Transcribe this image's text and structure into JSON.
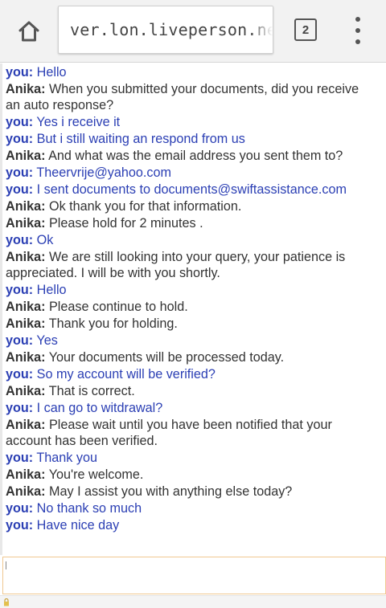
{
  "browser": {
    "url": "ver.lon.liveperson.net/",
    "tab_count": "2",
    "icons": {
      "home": "home-icon",
      "tabs": "tab-switcher-icon",
      "menu": "overflow-menu-icon",
      "secure": "lock-icon"
    }
  },
  "colors": {
    "you": "#2b3fb4",
    "agent": "#333333",
    "input_border": "#f0c890"
  },
  "chat": {
    "messages": [
      {
        "sender": "you",
        "label": "you:",
        "text": "Hello"
      },
      {
        "sender": "agent",
        "label": "Anika:",
        "text": "When you submitted your documents, did you receive an auto response?"
      },
      {
        "sender": "you",
        "label": "you:",
        "text": "Yes i receive it"
      },
      {
        "sender": "you",
        "label": "you:",
        "text": "But i still waiting an respond from us"
      },
      {
        "sender": "agent",
        "label": "Anika:",
        "text": "And what was the email address you sent them to?"
      },
      {
        "sender": "you",
        "label": "you:",
        "text": "Theervrije@yahoo.com"
      },
      {
        "sender": "you",
        "label": "you:",
        "text": "I sent documents to documents@swiftassistance.com"
      },
      {
        "sender": "agent",
        "label": "Anika:",
        "text": "Ok thank you for that information."
      },
      {
        "sender": "agent",
        "label": "Anika:",
        "text": "Please hold for 2 minutes ."
      },
      {
        "sender": "you",
        "label": "you:",
        "text": "Ok"
      },
      {
        "sender": "agent",
        "label": "Anika:",
        "text": "We are still looking into your query, your patience is appreciated. I will be with you shortly."
      },
      {
        "sender": "you",
        "label": "you:",
        "text": "Hello"
      },
      {
        "sender": "agent",
        "label": "Anika:",
        "text": "Please continue to hold."
      },
      {
        "sender": "agent",
        "label": "Anika:",
        "text": "Thank you for holding."
      },
      {
        "sender": "you",
        "label": "you:",
        "text": "Yes"
      },
      {
        "sender": "agent",
        "label": "Anika:",
        "text": "Your documents will be processed today."
      },
      {
        "sender": "you",
        "label": "you:",
        "text": "So my account will be verified?"
      },
      {
        "sender": "agent",
        "label": "Anika:",
        "text": "That is correct."
      },
      {
        "sender": "you",
        "label": "you:",
        "text": "I can go to witdrawal?"
      },
      {
        "sender": "agent",
        "label": "Anika:",
        "text": "Please wait until you have been notified that your account has been verified."
      },
      {
        "sender": "you",
        "label": "you:",
        "text": "Thank you"
      },
      {
        "sender": "agent",
        "label": "Anika:",
        "text": "You're welcome."
      },
      {
        "sender": "agent",
        "label": "Anika:",
        "text": "May I assist you with anything else today?"
      },
      {
        "sender": "you",
        "label": "you:",
        "text": "No thank so much"
      },
      {
        "sender": "you",
        "label": "you:",
        "text": "Have nice day"
      }
    ],
    "input_value": ""
  }
}
